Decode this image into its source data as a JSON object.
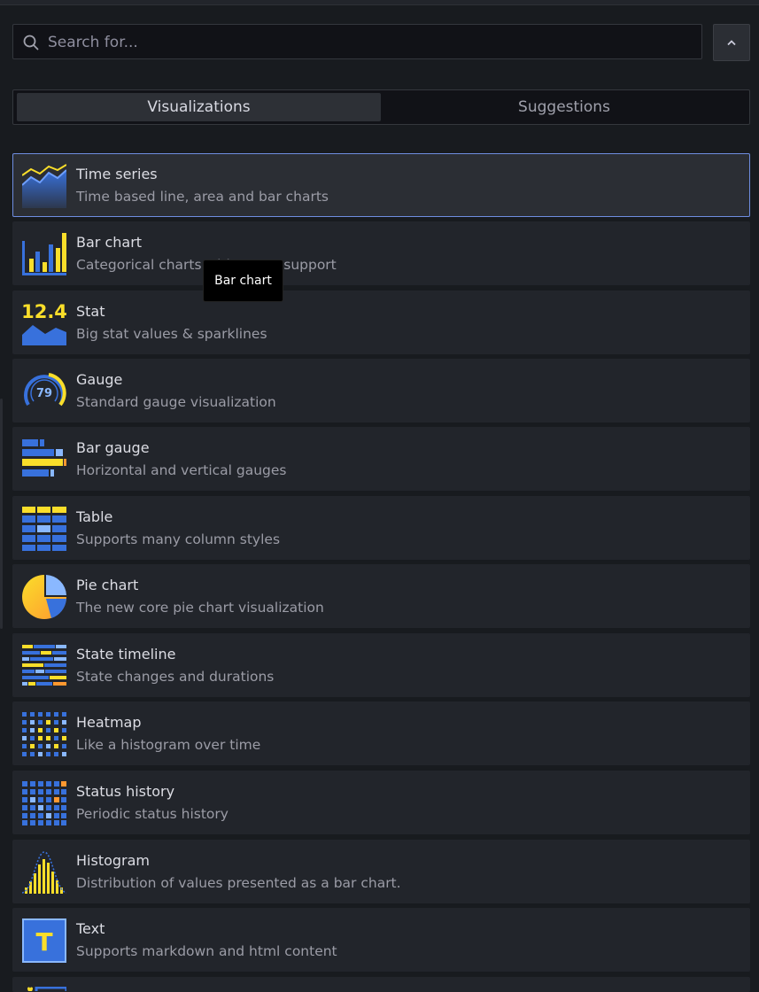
{
  "search": {
    "placeholder": "Search for..."
  },
  "tabs": [
    {
      "label": "Visualizations",
      "active": true
    },
    {
      "label": "Suggestions",
      "active": false
    }
  ],
  "visualizations": [
    {
      "title": "Time series",
      "description": "Time based line, area and bar charts",
      "icon": "time-series-icon",
      "selected": true
    },
    {
      "title": "Bar chart",
      "description": "Categorical charts with group support",
      "icon": "bar-chart-icon"
    },
    {
      "title": "Stat",
      "description": "Big stat values & sparklines",
      "icon": "stat-icon",
      "icon_text": "12.4"
    },
    {
      "title": "Gauge",
      "description": "Standard gauge visualization",
      "icon": "gauge-icon",
      "icon_text": "79"
    },
    {
      "title": "Bar gauge",
      "description": "Horizontal and vertical gauges",
      "icon": "bar-gauge-icon"
    },
    {
      "title": "Table",
      "description": "Supports many column styles",
      "icon": "table-icon"
    },
    {
      "title": "Pie chart",
      "description": "The new core pie chart visualization",
      "icon": "pie-chart-icon"
    },
    {
      "title": "State timeline",
      "description": "State changes and durations",
      "icon": "state-timeline-icon"
    },
    {
      "title": "Heatmap",
      "description": "Like a histogram over time",
      "icon": "heatmap-icon"
    },
    {
      "title": "Status history",
      "description": "Periodic status history",
      "icon": "status-history-icon"
    },
    {
      "title": "Histogram",
      "description": "Distribution of values presented as a bar chart.",
      "icon": "histogram-icon"
    },
    {
      "title": "Text",
      "description": "Supports markdown and html content",
      "icon": "text-icon",
      "icon_text": "T"
    },
    {
      "title": "",
      "description": "",
      "icon": "partial-item-icon"
    }
  ],
  "tooltip": {
    "text": "Bar chart"
  },
  "colors": {
    "accent_blue": "#3871dc",
    "light_blue": "#8ab8ff",
    "yellow": "#fade2a",
    "orange": "#ff9830",
    "selected_border": "#6e8de0"
  }
}
